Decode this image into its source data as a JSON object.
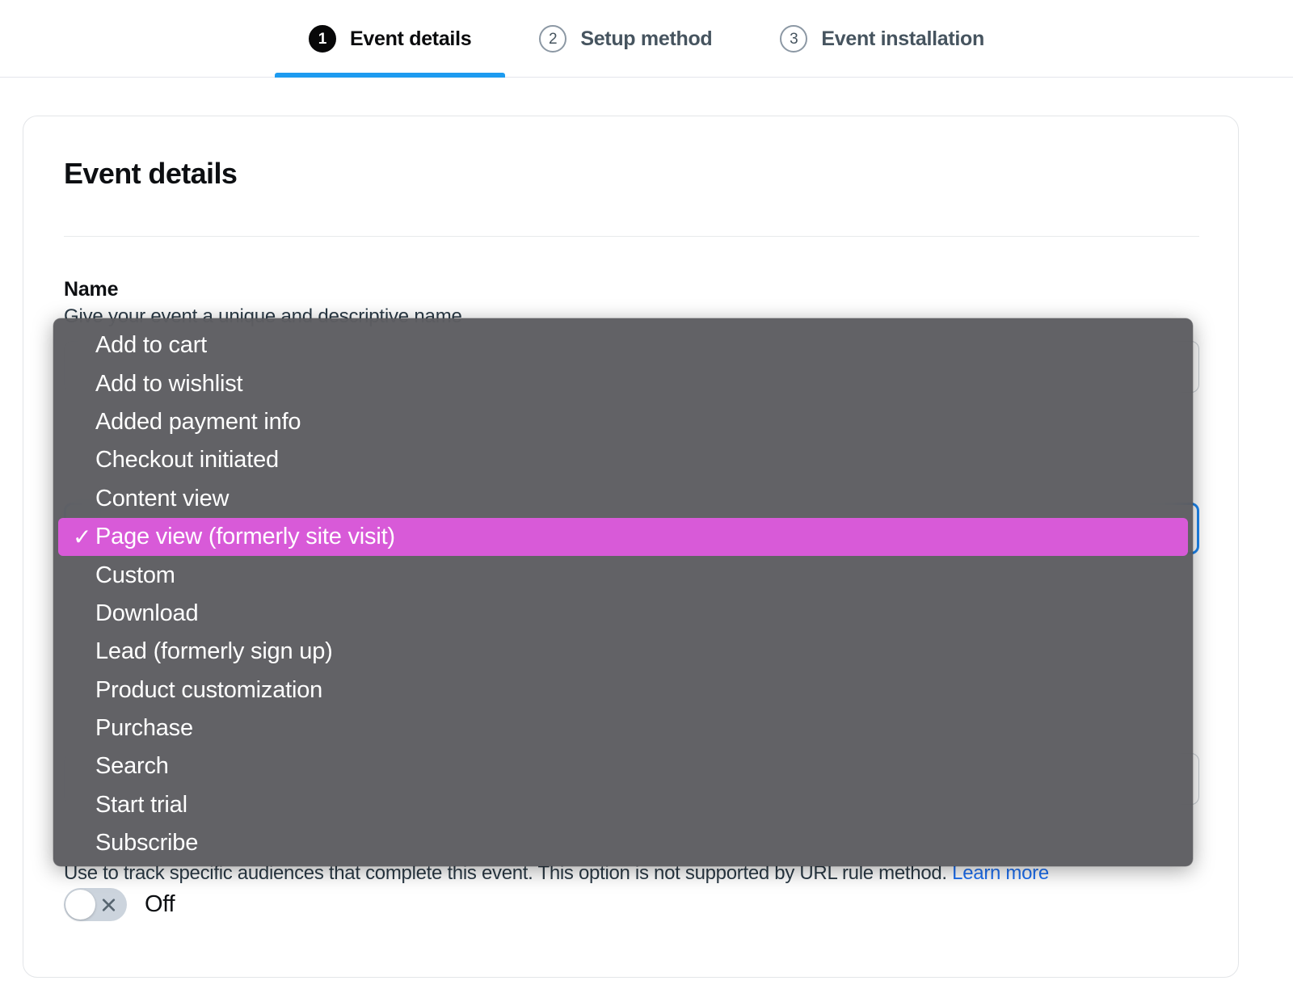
{
  "stepper": {
    "steps": [
      {
        "number": "1",
        "label": "Event details",
        "state": "active"
      },
      {
        "number": "2",
        "label": "Setup method",
        "state": "inactive"
      },
      {
        "number": "3",
        "label": "Event installation",
        "state": "inactive"
      }
    ]
  },
  "card": {
    "title": "Event details",
    "name_field": {
      "label": "Name",
      "help": "Give your event a unique and descriptive name",
      "value": ""
    },
    "audience": {
      "help_text": "Use to track specific audiences that complete this event. This option is not supported by URL rule method.",
      "learn_more_label": "Learn more",
      "toggle_state_label": "Off",
      "toggle_on": false
    }
  },
  "select_popup": {
    "selected_value": "Page view (formerly site visit)",
    "options": [
      "Add to cart",
      "Add to wishlist",
      "Added payment info",
      "Checkout initiated",
      "Content view",
      "Page view (formerly site visit)",
      "Custom",
      "Download",
      "Lead (formerly sign up)",
      "Product customization",
      "Purchase",
      "Search",
      "Start trial",
      "Subscribe"
    ],
    "checkmark_glyph": "✓"
  },
  "colors": {
    "accent_blue": "#1d9bf0",
    "link_blue": "#1d6ff0",
    "highlight_magenta": "#d85ad8",
    "popup_bg": "#56565a",
    "step_active": "#080809",
    "step_inactive": "#46545f"
  }
}
